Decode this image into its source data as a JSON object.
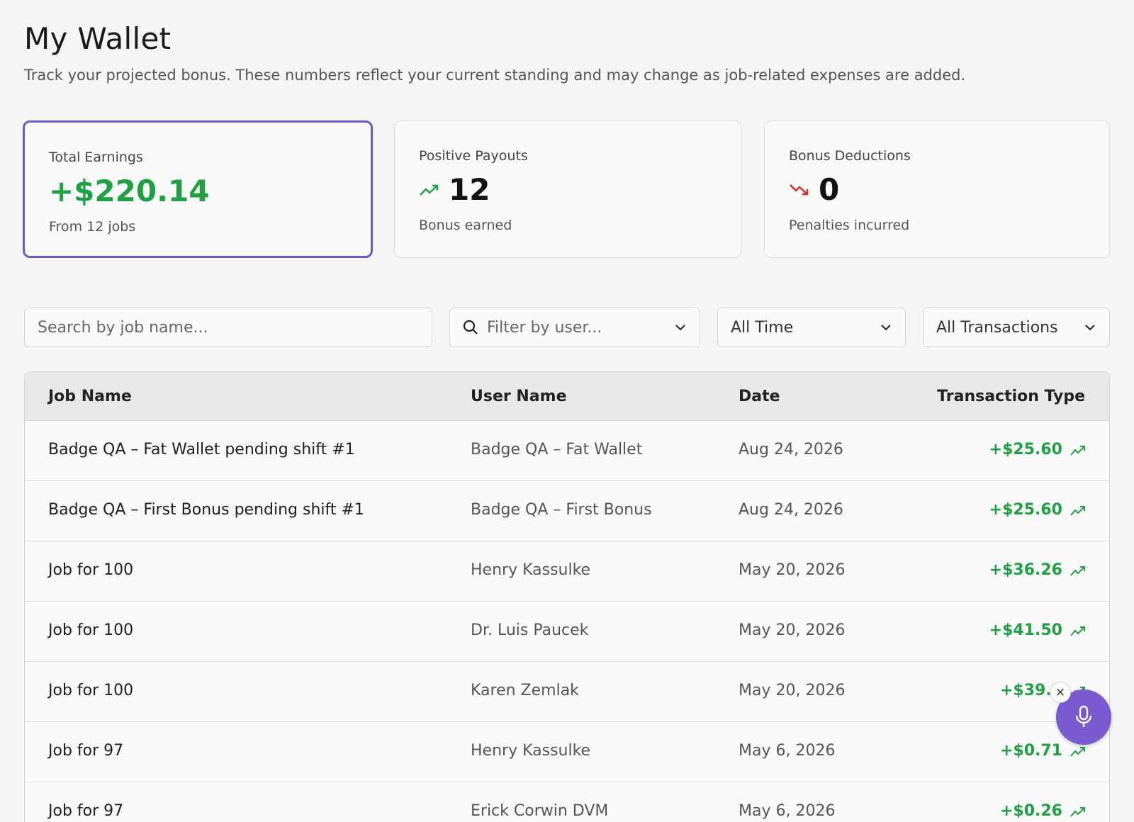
{
  "header": {
    "title": "My Wallet",
    "subtitle": "Track your projected bonus. These numbers reflect your current standing and may change as job-related expenses are added."
  },
  "cards": {
    "total": {
      "label": "Total Earnings",
      "value": "+$220.14",
      "sub": "From 12 jobs"
    },
    "positive": {
      "label": "Positive Payouts",
      "value": "12",
      "sub": "Bonus earned",
      "icon": "trending-up-icon"
    },
    "deductions": {
      "label": "Bonus Deductions",
      "value": "0",
      "sub": "Penalties incurred",
      "icon": "trending-down-icon"
    }
  },
  "filters": {
    "search_placeholder": "Search by job name...",
    "user_placeholder": "Filter by user...",
    "time_value": "All Time",
    "type_value": "All Transactions"
  },
  "table": {
    "headers": {
      "job": "Job Name",
      "user": "User Name",
      "date": "Date",
      "type": "Transaction Type"
    },
    "rows": [
      {
        "job": "Badge QA – Fat Wallet pending shift #1",
        "user": "Badge QA – Fat Wallet",
        "date": "Aug 24, 2026",
        "amount": "+$25.60"
      },
      {
        "job": "Badge QA – First Bonus pending shift #1",
        "user": "Badge QA – First Bonus",
        "date": "Aug 24, 2026",
        "amount": "+$25.60"
      },
      {
        "job": "Job for 100",
        "user": "Henry Kassulke",
        "date": "May 20, 2026",
        "amount": "+$36.26"
      },
      {
        "job": "Job for 100",
        "user": "Dr. Luis Paucek",
        "date": "May 20, 2026",
        "amount": "+$41.50"
      },
      {
        "job": "Job for 100",
        "user": "Karen Zemlak",
        "date": "May 20, 2026",
        "amount": "+$39.4"
      },
      {
        "job": "Job for 97",
        "user": "Henry Kassulke",
        "date": "May 6, 2026",
        "amount": "+$0.71"
      },
      {
        "job": "Job for 97",
        "user": "Erick Corwin DVM",
        "date": "May 6, 2026",
        "amount": "+$0.26"
      }
    ]
  },
  "colors": {
    "accent": "#6b5bc9",
    "positive": "#1ea043",
    "negative": "#d62828",
    "mic": "#7a5ad0"
  },
  "voice_widget": {
    "close_label": "×"
  }
}
